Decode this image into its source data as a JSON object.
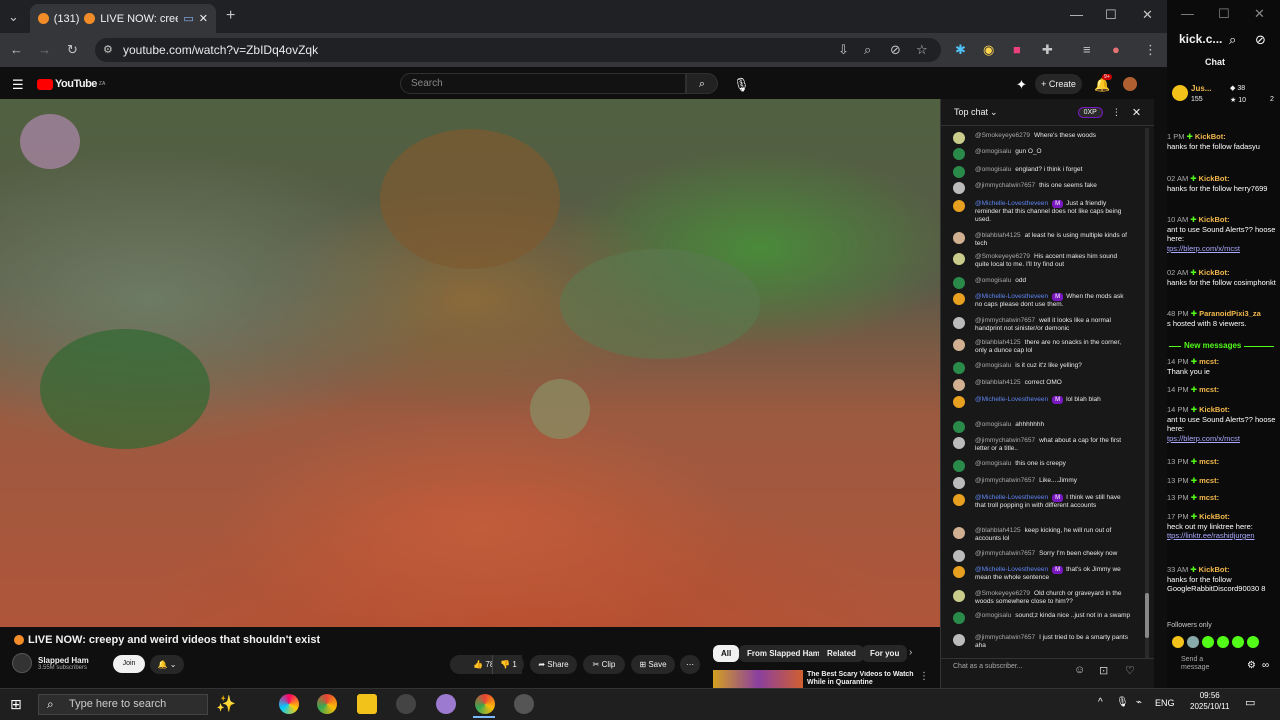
{
  "browser": {
    "tab_count": "(131)",
    "tab_title": "LIVE NOW: creep",
    "url": "youtube.com/watch?v=ZbIDq4ovZqk"
  },
  "youtube": {
    "logo_text": "YouTube",
    "logo_region": "ZA",
    "search_placeholder": "Search",
    "create_label": "Create",
    "notif_count": "9+"
  },
  "video": {
    "title": "LIVE NOW: creepy and weird videos that shouldn't exist",
    "channel": "Slapped Ham",
    "subscribers": "3.55M subscribers",
    "join_label": "Join",
    "likes": "782",
    "dislikes": "1",
    "share_label": "Share",
    "clip_label": "Clip",
    "save_label": "Save"
  },
  "recommend": {
    "chips": [
      "All",
      "From Slapped Ham",
      "Related",
      "For you"
    ],
    "first_title": "The Best Scary Videos to Watch While in Quarantine"
  },
  "chat": {
    "header": "Top chat",
    "xp_label": "0XP",
    "input_placeholder": "Chat as a subscriber...",
    "messages": [
      {
        "author": "@Smokeyeye6279",
        "text": "Where's these woods",
        "mod": false,
        "color": "#c9cc8a"
      },
      {
        "author": "@omogisalu",
        "text": "gun O_O",
        "mod": false,
        "color": "#2a8a4a"
      },
      {
        "author": "@omogisalu",
        "text": "england? i think i forget",
        "mod": false,
        "color": "#2a8a4a"
      },
      {
        "author": "@jimmychatwin7657",
        "text": "this one seems fake",
        "mod": false,
        "color": "#bbbbbb"
      },
      {
        "author": "@Michelle-Lovestheveen",
        "text": "Just a friendly reminder that this channel does not like caps being used.",
        "mod": true,
        "color": "#e8a020"
      },
      {
        "author": "@blahblah4125",
        "text": "at least he is using multiple kinds of tech",
        "mod": false,
        "color": "#d0b090"
      },
      {
        "author": "@Smokeyeye6279",
        "text": "His accent makes him sound quite local to me. I'll try find out",
        "mod": false,
        "color": "#c9cc8a"
      },
      {
        "author": "@omogisalu",
        "text": "odd",
        "mod": false,
        "color": "#2a8a4a"
      },
      {
        "author": "@Michelle-Lovestheveen",
        "text": "When the mods ask no caps please dont use them.",
        "mod": true,
        "color": "#e8a020"
      },
      {
        "author": "@jimmychatwin7657",
        "text": "well it looks like a normal handprint not sinister/or demonic",
        "mod": false,
        "color": "#bbbbbb"
      },
      {
        "author": "@blahblah4125",
        "text": "there are no snacks in the corner, only a dunce cap lol",
        "mod": false,
        "color": "#d0b090"
      },
      {
        "author": "@omogisalu",
        "text": "is it cuz it'z like yelling?",
        "mod": false,
        "color": "#2a8a4a"
      },
      {
        "author": "@blahblah4125",
        "text": "correct OMO",
        "mod": false,
        "color": "#d0b090"
      },
      {
        "author": "@Michelle-Lovestheveen",
        "text": "lol blah blah",
        "mod": true,
        "color": "#e8a020"
      },
      {
        "author": "@omogisalu",
        "text": "ahhhhhhh",
        "mod": false,
        "color": "#2a8a4a"
      },
      {
        "author": "@jimmychatwin7657",
        "text": "what about a cap for the first letter or a title..",
        "mod": false,
        "color": "#bbbbbb"
      },
      {
        "author": "@omogisalu",
        "text": "this one is creepy",
        "mod": false,
        "color": "#2a8a4a"
      },
      {
        "author": "@jimmychatwin7657",
        "text": "Like....Jimmy",
        "mod": false,
        "color": "#bbbbbb"
      },
      {
        "author": "@Michelle-Lovestheveen",
        "text": "I think we still have that troll popping in with different accounts",
        "mod": true,
        "color": "#e8a020"
      },
      {
        "author": "@blahblah4125",
        "text": "keep kicking, he will run out of accounts lol",
        "mod": false,
        "color": "#d0b090"
      },
      {
        "author": "@jimmychatwin7657",
        "text": "Sorry I'm been cheeky now",
        "mod": false,
        "color": "#bbbbbb"
      },
      {
        "author": "@Michelle-Lovestheveen",
        "text": "that's ok Jimmy we mean the whole sentence",
        "mod": true,
        "color": "#e8a020"
      },
      {
        "author": "@Smokeyeye6279",
        "text": "Old church or graveyard in the woods somewhere close to him??",
        "mod": false,
        "color": "#c9cc8a"
      },
      {
        "author": "@omogisalu",
        "text": "sound;z kinda nice ..just not in a swamp",
        "mod": false,
        "color": "#2a8a4a"
      },
      {
        "author": "@jimmychatwin7657",
        "text": "I just tried to be a smarty pants aha",
        "mod": false,
        "color": "#bbbbbb"
      }
    ]
  },
  "kick": {
    "title": "kick.c...",
    "chat_label": "Chat",
    "user_short": "Jus...",
    "stats": [
      "155",
      "38",
      "10",
      "2"
    ],
    "new_messages": "New messages",
    "followers_only": "Followers only",
    "send_placeholder": "Send a message",
    "lines": [
      {
        "time": "1 PM",
        "bot": "KickBot:",
        "text": "hanks for the follow fadasyu"
      },
      {
        "time": "02 AM",
        "bot": "KickBot:",
        "text": "hanks for the follow herry7699"
      },
      {
        "time": "10 AM",
        "bot": "KickBot:",
        "text": "ant to use Sound Alerts?? hoose here:",
        "link": "tps://blerp.com/x/mcst"
      },
      {
        "time": "02 AM",
        "bot": "KickBot:",
        "text": "hanks for the follow cosimphonkt"
      },
      {
        "time": "48 PM",
        "bot": "ParanoidPixi3_za",
        "text": "s hosted with 8 viewers."
      },
      {
        "time": "14 PM",
        "bot": "mcst:",
        "text": "Thank you ie"
      },
      {
        "time": "14 PM",
        "bot": "mcst:",
        "text": ""
      },
      {
        "time": "14 PM",
        "bot": "KickBot:",
        "text": "ant to use Sound Alerts?? hoose here:",
        "link": "tps://blerp.com/x/mcst"
      },
      {
        "time": "13 PM",
        "bot": "mcst:",
        "text": ""
      },
      {
        "time": "13 PM",
        "bot": "mcst:",
        "text": ""
      },
      {
        "time": "13 PM",
        "bot": "mcst:",
        "text": ""
      },
      {
        "time": "17 PM",
        "bot": "KickBot:",
        "text": "heck out my linktree here:",
        "link": "ttps://linktr.ee/rashidjurgen"
      },
      {
        "time": "33 AM",
        "bot": "KickBot:",
        "text": "hanks for the follow GoogleRabbitDiscord90030 8"
      }
    ]
  },
  "taskbar": {
    "search_placeholder": "Type here to search",
    "lang": "ENG",
    "time": "09:56",
    "date": "2025/10/11"
  },
  "colors": {
    "accent": "#ff0000",
    "kick_green": "#53fc18",
    "mod_purple": "#7a18c0"
  }
}
